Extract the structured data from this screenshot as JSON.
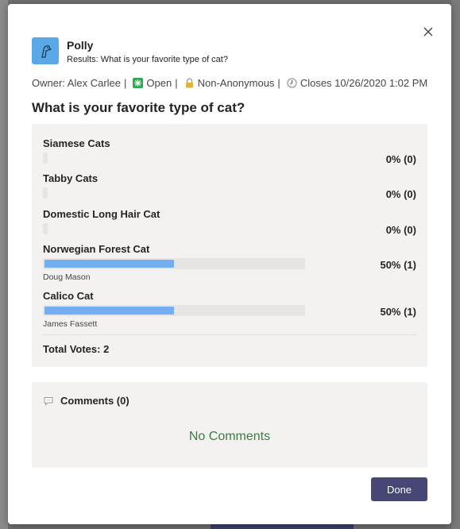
{
  "app": {
    "name": "Polly",
    "subtitle": "Results: What is your favorite type of cat?"
  },
  "meta": {
    "owner": "Owner: Alex Carlee",
    "separator": "|",
    "status": "Open",
    "anonymity": "Non-Anonymous",
    "closes": "Closes 10/26/2020 1:02 PM"
  },
  "question": "What is your favorite type of cat?",
  "options": [
    {
      "label": "Siamese Cats",
      "percent_text": "0% (0)",
      "fraction": 0,
      "voters": ""
    },
    {
      "label": "Tabby Cats",
      "percent_text": "0% (0)",
      "fraction": 0,
      "voters": ""
    },
    {
      "label": "Domestic Long Hair Cat",
      "percent_text": "0% (0)",
      "fraction": 0,
      "voters": ""
    },
    {
      "label": "Norwegian Forest Cat",
      "percent_text": "50% (1)",
      "fraction": 0.5,
      "voters": "Doug Mason"
    },
    {
      "label": "Calico Cat",
      "percent_text": "50% (1)",
      "fraction": 0.5,
      "voters": "James Fassett"
    }
  ],
  "total_votes": "Total Votes: 2",
  "comments": {
    "header": "Comments (0)",
    "empty_text": "No Comments"
  },
  "buttons": {
    "done": "Done"
  },
  "colors": {
    "bar_fill": "#74aef2",
    "done_button": "#464775",
    "no_comments_text": "#3a7d44",
    "app_icon_bg": "#5aa8e6"
  }
}
